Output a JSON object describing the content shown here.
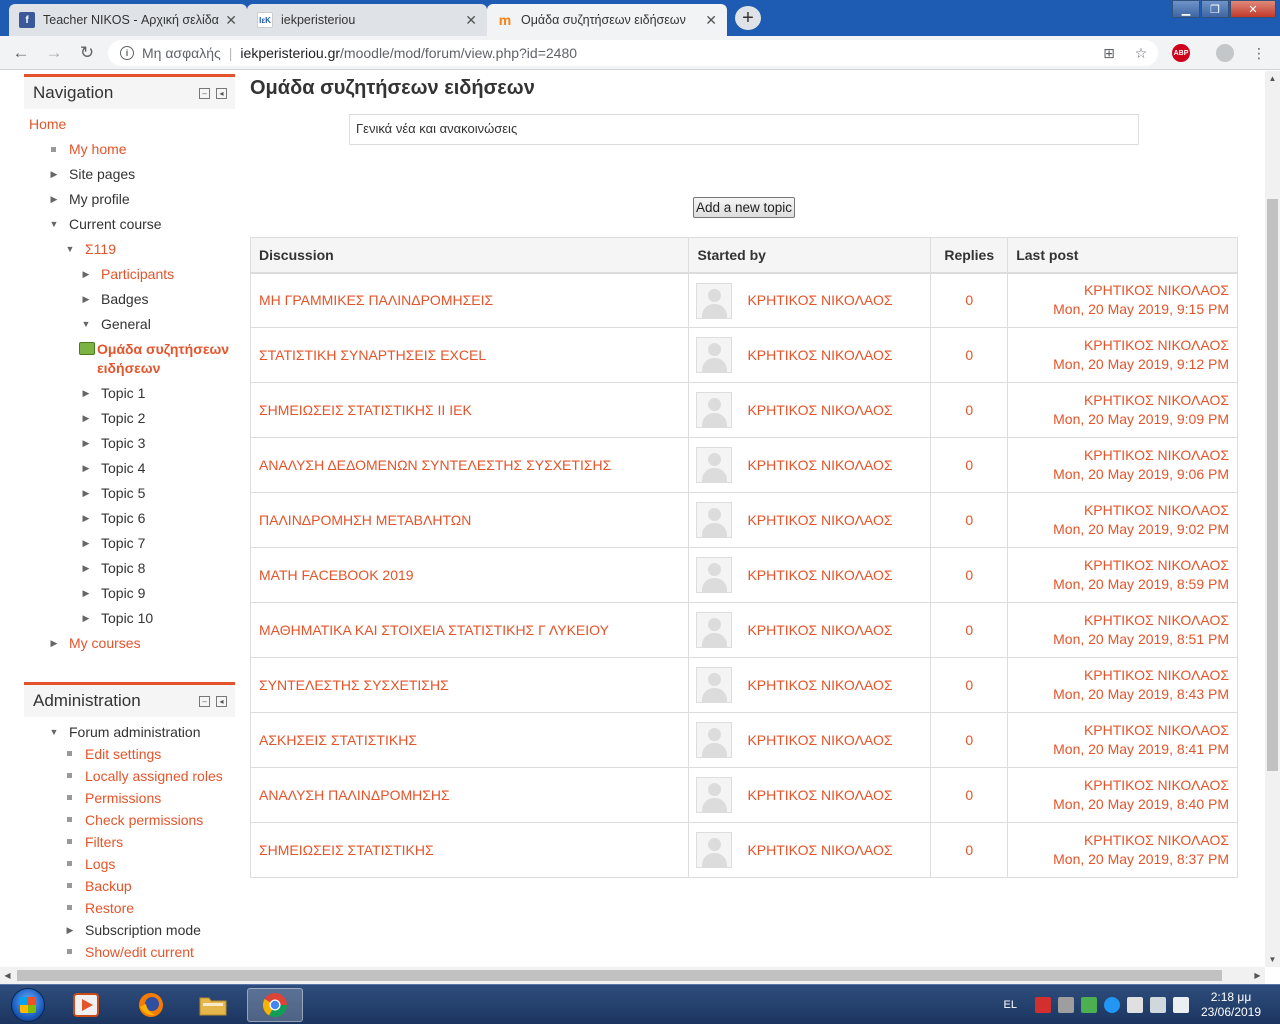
{
  "browser": {
    "tabs": [
      {
        "title": "Teacher NIKOS - Αρχική σελίδα",
        "favicon": "facebook-icon",
        "active": false
      },
      {
        "title": "iekperisteriou",
        "favicon": "iek-icon",
        "active": false
      },
      {
        "title": "Ομάδα συζητήσεων ειδήσεων",
        "favicon": "moodle-icon",
        "active": true
      }
    ],
    "security_label": "Μη ασφαλής",
    "url_host": "iekperisteriou.gr",
    "url_path": "/moodle/mod/forum/view.php?id=2480",
    "abp_label": "ABP"
  },
  "navigation": {
    "title": "Navigation",
    "items": [
      {
        "label": "Home",
        "level": 0,
        "marker": "none",
        "style": "link"
      },
      {
        "label": "My home",
        "level": 1,
        "marker": "bullet",
        "style": "link"
      },
      {
        "label": "Site pages",
        "level": 1,
        "marker": "collapsed",
        "style": "plain"
      },
      {
        "label": "My profile",
        "level": 1,
        "marker": "collapsed",
        "style": "plain"
      },
      {
        "label": "Current course",
        "level": 1,
        "marker": "expanded",
        "style": "plain"
      },
      {
        "label": "Σ119",
        "level": 2,
        "marker": "expanded",
        "style": "link"
      },
      {
        "label": "Participants",
        "level": 3,
        "marker": "collapsed",
        "style": "link"
      },
      {
        "label": "Badges",
        "level": 3,
        "marker": "collapsed",
        "style": "plain"
      },
      {
        "label": "General",
        "level": 3,
        "marker": "expanded",
        "style": "plain"
      },
      {
        "label": "Ομάδα συζητήσεων ειδήσεων",
        "level": 4,
        "marker": "forum",
        "style": "active"
      },
      {
        "label": "Topic 1",
        "level": 3,
        "marker": "collapsed",
        "style": "plain"
      },
      {
        "label": "Topic 2",
        "level": 3,
        "marker": "collapsed",
        "style": "plain"
      },
      {
        "label": "Topic 3",
        "level": 3,
        "marker": "collapsed",
        "style": "plain"
      },
      {
        "label": "Topic 4",
        "level": 3,
        "marker": "collapsed",
        "style": "plain"
      },
      {
        "label": "Topic 5",
        "level": 3,
        "marker": "collapsed",
        "style": "plain"
      },
      {
        "label": "Topic 6",
        "level": 3,
        "marker": "collapsed",
        "style": "plain"
      },
      {
        "label": "Topic 7",
        "level": 3,
        "marker": "collapsed",
        "style": "plain"
      },
      {
        "label": "Topic 8",
        "level": 3,
        "marker": "collapsed",
        "style": "plain"
      },
      {
        "label": "Topic 9",
        "level": 3,
        "marker": "collapsed",
        "style": "plain"
      },
      {
        "label": "Topic 10",
        "level": 3,
        "marker": "collapsed",
        "style": "plain"
      },
      {
        "label": "My courses",
        "level": 1,
        "marker": "collapsed",
        "style": "link"
      }
    ]
  },
  "administration": {
    "title": "Administration",
    "items": [
      {
        "label": "Forum administration",
        "level": 1,
        "marker": "expanded",
        "style": "plain"
      },
      {
        "label": "Edit settings",
        "level": 2,
        "marker": "bullet",
        "style": "link"
      },
      {
        "label": "Locally assigned roles",
        "level": 2,
        "marker": "bullet",
        "style": "link"
      },
      {
        "label": "Permissions",
        "level": 2,
        "marker": "bullet",
        "style": "link"
      },
      {
        "label": "Check permissions",
        "level": 2,
        "marker": "bullet",
        "style": "link"
      },
      {
        "label": "Filters",
        "level": 2,
        "marker": "bullet",
        "style": "link"
      },
      {
        "label": "Logs",
        "level": 2,
        "marker": "bullet",
        "style": "link"
      },
      {
        "label": "Backup",
        "level": 2,
        "marker": "bullet",
        "style": "link"
      },
      {
        "label": "Restore",
        "level": 2,
        "marker": "bullet",
        "style": "link"
      },
      {
        "label": "Subscription mode",
        "level": 2,
        "marker": "collapsed",
        "style": "plain"
      },
      {
        "label": "Show/edit current",
        "level": 2,
        "marker": "bullet",
        "style": "link"
      }
    ]
  },
  "forum": {
    "title": "Ομάδα συζητήσεων ειδήσεων",
    "intro": "Γενικά νέα και ανακοινώσεις",
    "add_topic_label": "Add a new topic",
    "columns": {
      "discussion": "Discussion",
      "started_by": "Started by",
      "replies": "Replies",
      "last_post": "Last post"
    },
    "discussions": [
      {
        "title": "ΜΗ ΓΡΑΜΜΙΚΕΣ ΠΑΛΙΝΔΡΟΜΗΣΕΙΣ",
        "author": "ΚΡΗΤΙΚΟΣ ΝΙΚΟΛΑΟΣ",
        "replies": "0",
        "last_author": "ΚΡΗΤΙΚΟΣ ΝΙΚΟΛΑΟΣ",
        "last_date": "Mon, 20 May 2019, 9:15 PM"
      },
      {
        "title": "ΣΤΑΤΙΣΤΙΚΗ ΣΥΝΑΡΤΗΣΕΙΣ EXCEL",
        "author": "ΚΡΗΤΙΚΟΣ ΝΙΚΟΛΑΟΣ",
        "replies": "0",
        "last_author": "ΚΡΗΤΙΚΟΣ ΝΙΚΟΛΑΟΣ",
        "last_date": "Mon, 20 May 2019, 9:12 PM"
      },
      {
        "title": "ΣΗΜΕΙΩΣΕΙΣ ΣΤΑΤΙΣΤΙΚΗΣ ΙΙ ΙΕΚ",
        "author": "ΚΡΗΤΙΚΟΣ ΝΙΚΟΛΑΟΣ",
        "replies": "0",
        "last_author": "ΚΡΗΤΙΚΟΣ ΝΙΚΟΛΑΟΣ",
        "last_date": "Mon, 20 May 2019, 9:09 PM"
      },
      {
        "title": "ΑΝΑΛΥΣΗ ΔΕΔΟΜΕΝΩΝ ΣΥΝΤΕΛΕΣΤΗΣ ΣΥΣΧΕΤΙΣΗΣ",
        "author": "ΚΡΗΤΙΚΟΣ ΝΙΚΟΛΑΟΣ",
        "replies": "0",
        "last_author": "ΚΡΗΤΙΚΟΣ ΝΙΚΟΛΑΟΣ",
        "last_date": "Mon, 20 May 2019, 9:06 PM"
      },
      {
        "title": "ΠΑΛΙΝΔΡΟΜΗΣΗ ΜΕΤΑΒΛΗΤΩΝ",
        "author": "ΚΡΗΤΙΚΟΣ ΝΙΚΟΛΑΟΣ",
        "replies": "0",
        "last_author": "ΚΡΗΤΙΚΟΣ ΝΙΚΟΛΑΟΣ",
        "last_date": "Mon, 20 May 2019, 9:02 PM"
      },
      {
        "title": "MATH FACEBOOK 2019",
        "author": "ΚΡΗΤΙΚΟΣ ΝΙΚΟΛΑΟΣ",
        "replies": "0",
        "last_author": "ΚΡΗΤΙΚΟΣ ΝΙΚΟΛΑΟΣ",
        "last_date": "Mon, 20 May 2019, 8:59 PM"
      },
      {
        "title": "ΜΑΘΗΜΑΤΙΚΑ ΚΑΙ ΣΤΟΙΧΕΙΑ ΣΤΑΤΙΣΤΙΚΗΣ Γ ΛΥΚΕΙΟΥ",
        "author": "ΚΡΗΤΙΚΟΣ ΝΙΚΟΛΑΟΣ",
        "replies": "0",
        "last_author": "ΚΡΗΤΙΚΟΣ ΝΙΚΟΛΑΟΣ",
        "last_date": "Mon, 20 May 2019, 8:51 PM"
      },
      {
        "title": "ΣΥΝΤΕΛΕΣΤΗΣ ΣΥΣΧΕΤΙΣΗΣ",
        "author": "ΚΡΗΤΙΚΟΣ ΝΙΚΟΛΑΟΣ",
        "replies": "0",
        "last_author": "ΚΡΗΤΙΚΟΣ ΝΙΚΟΛΑΟΣ",
        "last_date": "Mon, 20 May 2019, 8:43 PM"
      },
      {
        "title": "ΑΣΚΗΣΕΙΣ ΣΤΑΤΙΣΤΙΚΗΣ",
        "author": "ΚΡΗΤΙΚΟΣ ΝΙΚΟΛΑΟΣ",
        "replies": "0",
        "last_author": "ΚΡΗΤΙΚΟΣ ΝΙΚΟΛΑΟΣ",
        "last_date": "Mon, 20 May 2019, 8:41 PM"
      },
      {
        "title": "ΑΝΑΛΥΣΗ ΠΑΛΙΝΔΡΟΜΗΣΗΣ",
        "author": "ΚΡΗΤΙΚΟΣ ΝΙΚΟΛΑΟΣ",
        "replies": "0",
        "last_author": "ΚΡΗΤΙΚΟΣ ΝΙΚΟΛΑΟΣ",
        "last_date": "Mon, 20 May 2019, 8:40 PM"
      },
      {
        "title": "ΣΗΜΕΙΩΣΕΙΣ ΣΤΑΤΙΣΤΙΚΗΣ",
        "author": "ΚΡΗΤΙΚΟΣ ΝΙΚΟΛΑΟΣ",
        "replies": "0",
        "last_author": "ΚΡΗΤΙΚΟΣ ΝΙΚΟΛΑΟΣ",
        "last_date": "Mon, 20 May 2019, 8:37 PM"
      }
    ]
  },
  "taskbar": {
    "language": "EL",
    "time": "2:18 μμ",
    "date": "23/06/2019"
  },
  "colors": {
    "accent": "#e4542a",
    "titlebar": "#1e5bb3",
    "taskbar": "#1c3560"
  }
}
